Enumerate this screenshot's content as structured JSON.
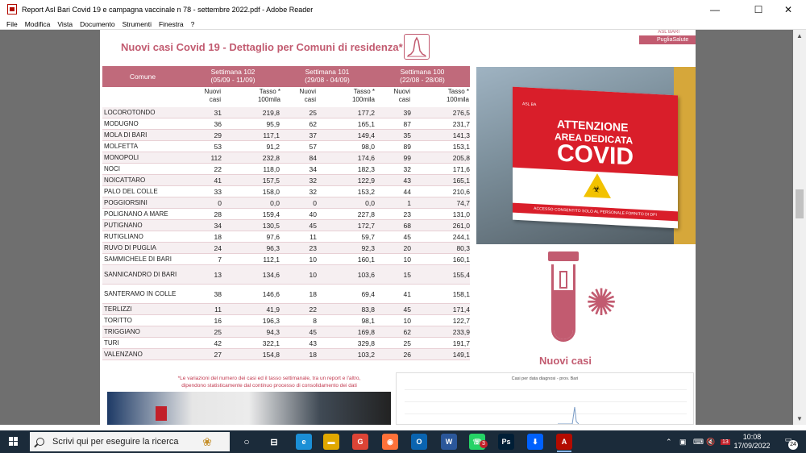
{
  "window": {
    "title": "Report Asl Bari Covid 19 e campagna vaccinale n 78 - settembre 2022.pdf - Adobe Reader",
    "controls": {
      "minimize": "—",
      "maximize": "☐",
      "close": "✕"
    }
  },
  "menu": [
    "File",
    "Modifica",
    "Vista",
    "Documento",
    "Strumenti",
    "Finestra",
    "?"
  ],
  "page": {
    "title": "Nuovi casi Covid 19 - Dettaglio per Comuni di residenza*",
    "logo_top": "ASL BARI",
    "logo_brand": "PugliaSalute",
    "table": {
      "col_comune": "Comune",
      "weeks": [
        {
          "label": "Settimana 102",
          "range": "(05/09 - 11/09)"
        },
        {
          "label": "Settimana 101",
          "range": "(29/08 - 04/09)"
        },
        {
          "label": "Settimana 100",
          "range": "(22/08 - 28/08)"
        }
      ],
      "sub_new_1": "Nuovi",
      "sub_new_2": "casi",
      "sub_rate_1": "Tasso *",
      "sub_rate_2": "100mila",
      "rows": [
        {
          "name": "LOCOROTONDO",
          "v": [
            "31",
            "219,8",
            "25",
            "177,2",
            "39",
            "276,5"
          ]
        },
        {
          "name": "MODUGNO",
          "v": [
            "36",
            "95,9",
            "62",
            "165,1",
            "87",
            "231,7"
          ]
        },
        {
          "name": "MOLA DI BARI",
          "v": [
            "29",
            "117,1",
            "37",
            "149,4",
            "35",
            "141,3"
          ]
        },
        {
          "name": "MOLFETTA",
          "v": [
            "53",
            "91,2",
            "57",
            "98,0",
            "89",
            "153,1"
          ]
        },
        {
          "name": "MONOPOLI",
          "v": [
            "112",
            "232,8",
            "84",
            "174,6",
            "99",
            "205,8"
          ]
        },
        {
          "name": "NOCI",
          "v": [
            "22",
            "118,0",
            "34",
            "182,3",
            "32",
            "171,6"
          ]
        },
        {
          "name": "NOICATTARO",
          "v": [
            "41",
            "157,5",
            "32",
            "122,9",
            "43",
            "165,1"
          ]
        },
        {
          "name": "PALO DEL COLLE",
          "v": [
            "33",
            "158,0",
            "32",
            "153,2",
            "44",
            "210,6"
          ]
        },
        {
          "name": "POGGIORSINI",
          "v": [
            "0",
            "0,0",
            "0",
            "0,0",
            "1",
            "74,7"
          ]
        },
        {
          "name": "POLIGNANO A MARE",
          "v": [
            "28",
            "159,4",
            "40",
            "227,8",
            "23",
            "131,0"
          ]
        },
        {
          "name": "PUTIGNANO",
          "v": [
            "34",
            "130,5",
            "45",
            "172,7",
            "68",
            "261,0"
          ]
        },
        {
          "name": "RUTIGLIANO",
          "v": [
            "18",
            "97,6",
            "11",
            "59,7",
            "45",
            "244,1"
          ]
        },
        {
          "name": "RUVO DI PUGLIA",
          "v": [
            "24",
            "96,3",
            "23",
            "92,3",
            "20",
            "80,3"
          ]
        },
        {
          "name": "SAMMICHELE DI BARI",
          "v": [
            "7",
            "112,1",
            "10",
            "160,1",
            "10",
            "160,1"
          ]
        },
        {
          "name": "SANNICANDRO DI BARI",
          "v": [
            "13",
            "134,6",
            "10",
            "103,6",
            "15",
            "155,4"
          ],
          "tall": true
        },
        {
          "name": "SANTERAMO IN COLLE",
          "v": [
            "38",
            "146,6",
            "18",
            "69,4",
            "41",
            "158,1"
          ],
          "tall": true
        },
        {
          "name": "TERLIZZI",
          "v": [
            "11",
            "41,9",
            "22",
            "83,8",
            "45",
            "171,4"
          ]
        },
        {
          "name": "TORITTO",
          "v": [
            "16",
            "196,3",
            "8",
            "98,1",
            "10",
            "122,7"
          ]
        },
        {
          "name": "TRIGGIANO",
          "v": [
            "25",
            "94,3",
            "45",
            "169,8",
            "62",
            "233,9"
          ]
        },
        {
          "name": "TURI",
          "v": [
            "42",
            "322,1",
            "43",
            "329,8",
            "25",
            "191,7"
          ]
        },
        {
          "name": "VALENZANO",
          "v": [
            "27",
            "154,8",
            "18",
            "103,2",
            "26",
            "149,1"
          ]
        }
      ]
    },
    "sign": {
      "logo": "ASL BA",
      "line1": "ATTENZIONE",
      "line2": "AREA DEDICATA",
      "line3": "COVID",
      "footer": "ACCESSO CONSENTITO SOLO AL PERSONALE FORNITO DI DPI"
    },
    "icon_label": "Nuovi casi",
    "footnote_1": "*Le variazioni del numero dei casi ed il tasso settimanale, tra un report e l'altro,",
    "footnote_2": "dipendono statisticamente dal continuo processo di consolidamento dei dati",
    "mini_chart_title": "Casi per data diagnosi - prov. Bari"
  },
  "taskbar": {
    "search_placeholder": "Scrivi qui per eseguire la ricerca",
    "apps": [
      {
        "label": "e",
        "color": "#1b8fd6"
      },
      {
        "label": "▬",
        "color": "#e0a800"
      },
      {
        "label": "G",
        "color": "#dd4436"
      },
      {
        "label": "◉",
        "color": "#ff7139"
      },
      {
        "label": "O",
        "color": "#0a64b0"
      },
      {
        "label": "W",
        "color": "#2b579a"
      },
      {
        "label": "☏",
        "color": "#25d366"
      },
      {
        "label": "Ps",
        "color": "#001e36"
      },
      {
        "label": "⬇",
        "color": "#0061fe"
      },
      {
        "label": "A",
        "color": "#b30b00"
      }
    ],
    "tray_badge": "13",
    "time": "10:08",
    "date": "17/09/2022",
    "notifications": "24",
    "whatsapp_badge": "3"
  }
}
